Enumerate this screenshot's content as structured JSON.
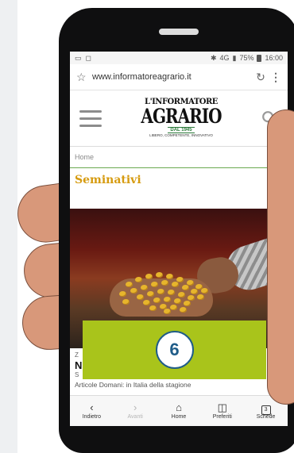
{
  "status_bar": {
    "left_icons": [
      "gallery-icon",
      "notification-icon"
    ],
    "signal": "4G",
    "battery": "75%",
    "time": "16:00"
  },
  "browser": {
    "url": "www.informatoreagrario.it"
  },
  "site": {
    "logo_line1": "L'INFORMATORE",
    "logo_line2": "AGRARIO",
    "logo_since": "DAL 1945",
    "logo_tagline": "LIBERO, COMPETENTE, INNOVATIVO"
  },
  "breadcrumb": "Home",
  "section_title": "Seminativi",
  "article": {
    "kicker": "Z",
    "headline": "N",
    "sub": "S",
    "desc": "Articole Domani: in Italia della stagione"
  },
  "overlay": {
    "badge_number": "6",
    "color": "#a9c41b"
  },
  "bottom_nav": [
    {
      "label": "Indietro",
      "icon": "chevron-left-icon",
      "enabled": true
    },
    {
      "label": "Avanti",
      "icon": "chevron-right-icon",
      "enabled": false
    },
    {
      "label": "Home",
      "icon": "home-icon",
      "enabled": true
    },
    {
      "label": "Preferiti",
      "icon": "bookmarks-icon",
      "enabled": true
    },
    {
      "label": "Schede",
      "icon": "tabs-icon",
      "tabs_count": "3",
      "enabled": true
    }
  ]
}
